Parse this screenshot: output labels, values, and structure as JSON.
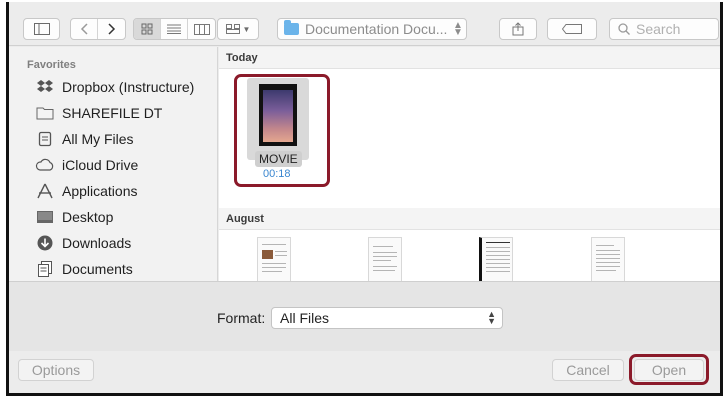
{
  "toolbar": {
    "location": "Documentation Docu...",
    "search_placeholder": "Search"
  },
  "sidebar": {
    "heading": "Favorites",
    "items": [
      {
        "label": "Dropbox (Instructure)",
        "icon": "dropbox-icon"
      },
      {
        "label": "SHAREFILE DT",
        "icon": "folder-icon"
      },
      {
        "label": "All My Files",
        "icon": "all-files-icon"
      },
      {
        "label": "iCloud Drive",
        "icon": "cloud-icon"
      },
      {
        "label": "Applications",
        "icon": "applications-icon"
      },
      {
        "label": "Desktop",
        "icon": "desktop-icon"
      },
      {
        "label": "Downloads",
        "icon": "downloads-icon"
      },
      {
        "label": "Documents",
        "icon": "documents-icon"
      }
    ]
  },
  "content": {
    "sections": [
      {
        "title": "Today"
      },
      {
        "title": "August"
      }
    ],
    "movie": {
      "name": "MOVIE",
      "duration": "00:18"
    },
    "highlight_color": "#8b1a2a"
  },
  "format": {
    "label": "Format:",
    "selected": "All Files"
  },
  "footer": {
    "options_label": "Options",
    "cancel_label": "Cancel",
    "open_label": "Open"
  }
}
